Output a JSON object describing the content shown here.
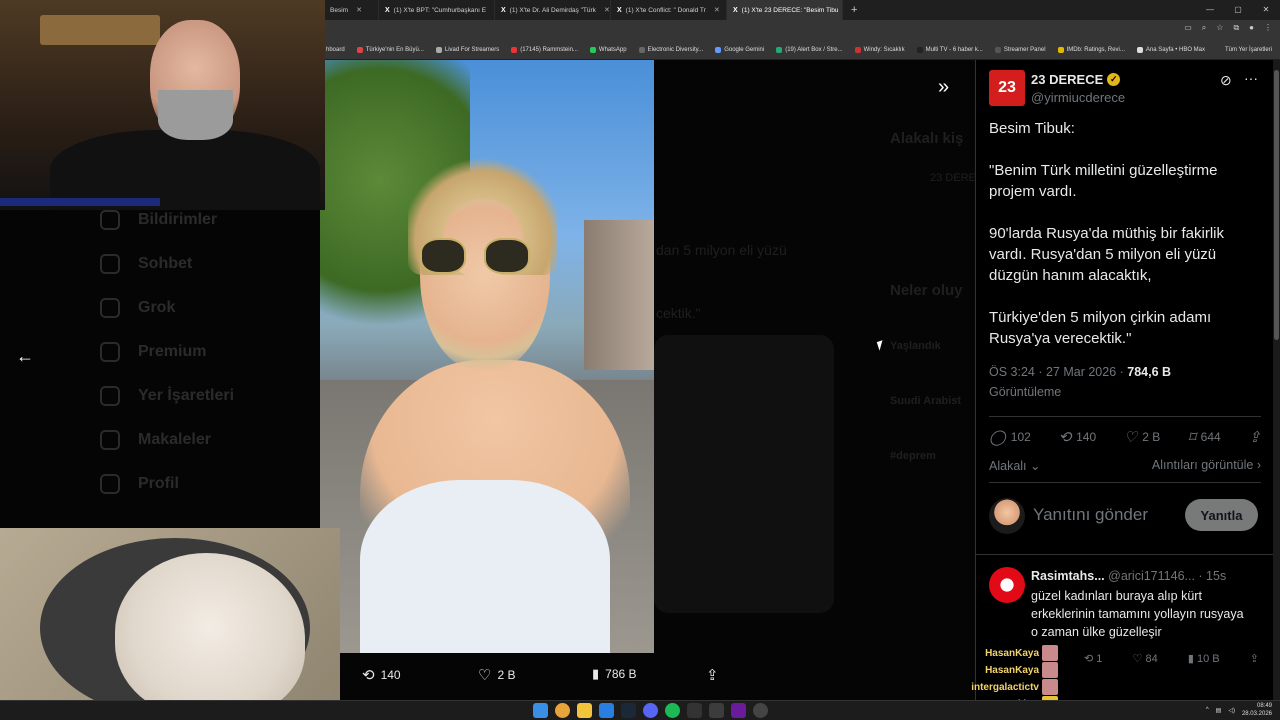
{
  "browser": {
    "tabs": [
      {
        "label": "Besim",
        "active": false
      },
      {
        "label": "(1) X'te BPT: \"Cumhurbaşkanı E",
        "active": false
      },
      {
        "label": "(1) X'te Dr. Ali Demirdaş \"Türk",
        "active": false
      },
      {
        "label": "(1) X'te Conflict: \" Donald Tr",
        "active": false
      },
      {
        "label": "(1) X'te 23 DERECE: \"Besim Tibu",
        "active": true
      }
    ],
    "bookmarks": [
      "hboard",
      "Türkiye'nin En Büyü...",
      "Livad For Streamers",
      "(17145) Rammstein...",
      "WhatsApp",
      "Electronic Diversity...",
      "Google Gemini",
      "(19) Alert Box / Stre...",
      "Windy: Sıcaklık",
      "Multi TV - 6 haber k...",
      "Streamer Panel",
      "IMDb: Ratings, Revi...",
      "Ana Sayfa • HBO Max"
    ],
    "bookmarks_all": "Tüm Yer İşaretleri"
  },
  "sidebar": {
    "items": [
      "Bildirimler",
      "Sohbet",
      "Grok",
      "Premium",
      "Yer İşaretleri",
      "Makaleler",
      "Profil"
    ]
  },
  "background_ghost": {
    "related_title": "Alakalı kiş",
    "account_name": "23 DERE",
    "trends_title": "Neler oluy",
    "text1": "dan 5 milyon eli yüzü",
    "text2": "cektik.\"",
    "trend1": "Yaşlandık",
    "trend2": "Suudi Arabist",
    "trend3": "#deprem"
  },
  "video_bar": {
    "retweets": "140",
    "likes": "2 B",
    "views": "786 B"
  },
  "tweet": {
    "account_name": "23 DERECE",
    "handle": "@yirmiucderece",
    "avatar_text": "23",
    "paragraphs": [
      "Besim Tibuk:",
      "\"Benim Türk milletini güzelleştirme projem vardı.",
      "90'larda Rusya'da müthiş bir fakirlik vardı. Rusya'dan 5 milyon eli yüzü düzgün hanım alacaktık,",
      "Türkiye'den 5 milyon çirkin adamı Rusya'ya verecektik.\""
    ],
    "time": "ÖS 3:24 · 27 Mar 2026 · ",
    "views_count": "784,6 B",
    "views_label": "Görüntüleme",
    "replies": "102",
    "retweets": "140",
    "likes": "2 B",
    "bookmarks": "644",
    "relevance": "Alakalı",
    "quotes_link": "Alıntıları görüntüle"
  },
  "reply_box": {
    "placeholder": "Yanıtını gönder",
    "button": "Yanıtla"
  },
  "reply": {
    "name": "Rasimtahs...",
    "handle": "@arici171146...",
    "time": "· 15s",
    "text": "güzel kadınları buraya alıp kürt erkeklerinin tamamını yollayın rusyaya o zaman ülke güzelleşir",
    "retweets": "1",
    "likes": "84",
    "views": "10 B"
  },
  "chat": [
    {
      "name": "HasanKaya"
    },
    {
      "name": "HasanKaya"
    },
    {
      "name": "intergalactictv"
    },
    {
      "name": "vakkur"
    }
  ],
  "taskbar": {
    "time": "08:49",
    "date": "28.03.2026"
  },
  "colors": {
    "x_bg": "#000000",
    "text_primary": "#e7e9ea",
    "text_secondary": "#71767b",
    "brand_red": "#d41e1e",
    "verified_gold": "#e2b719"
  }
}
